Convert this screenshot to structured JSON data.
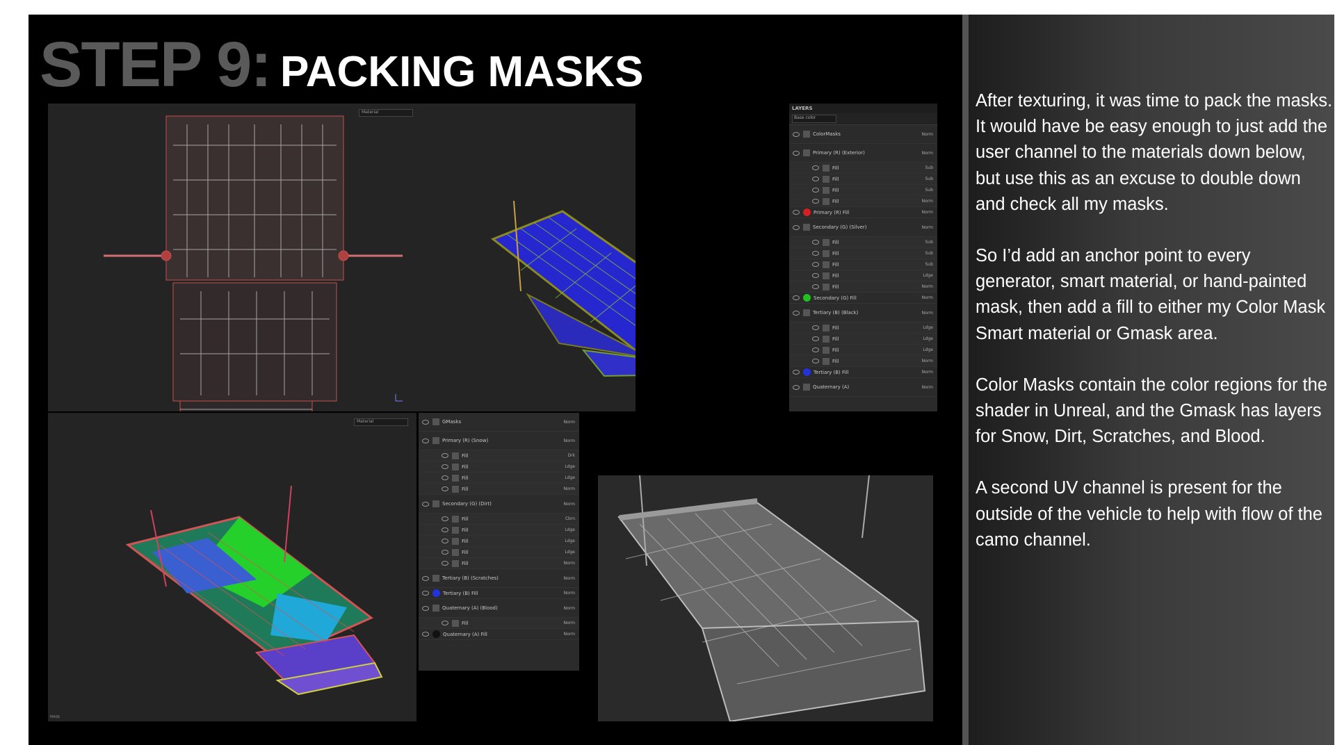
{
  "title": {
    "step": "STEP 9:",
    "main": "PACKING MASKS"
  },
  "description": [
    "After texturing, it was time to pack the masks. It would have be easy enough to just add the user channel to the materials down below, but use this as an excuse to double down and check all my masks.",
    "So I’d add an anchor point to every generator, smart material, or hand-painted mask, then add a fill to either my Color Mask Smart material or Gmask area.",
    "Color Masks contain the color regions for the shader in Unreal, and the Gmask has layers for Snow, Dirt, Scratches, and Blood.",
    "A second UV channel is present for the outside of the vehicle to help with flow of the camo channel."
  ],
  "viewport_top": {
    "dropdown": "Material"
  },
  "viewport_bottom": {
    "dropdown": "Material",
    "footer": "MASK"
  },
  "layers_panel_1": {
    "header": "LAYERS",
    "channel": "Base color",
    "rows": [
      {
        "type": "group",
        "name": "ColorMasks",
        "blend": "Norm"
      },
      {
        "type": "group",
        "name": "Primary (R) (Exterior)",
        "blend": "Norm"
      },
      {
        "type": "sub",
        "name": "Fill",
        "blend": "Sub"
      },
      {
        "type": "sub",
        "name": "Fill",
        "blend": "Sub"
      },
      {
        "type": "sub",
        "name": "Fill",
        "blend": "Sub"
      },
      {
        "type": "sub",
        "name": "Fill",
        "blend": "Norm"
      },
      {
        "type": "fill",
        "name": "Primary (R) Fill",
        "blend": "Norm",
        "ball": "#d42020"
      },
      {
        "type": "group",
        "name": "Secondary (G) (Silver)",
        "blend": "Norm"
      },
      {
        "type": "sub",
        "name": "Fill",
        "blend": "Sub"
      },
      {
        "type": "sub",
        "name": "Fill",
        "blend": "Sub"
      },
      {
        "type": "sub",
        "name": "Fill",
        "blend": "Sub"
      },
      {
        "type": "sub",
        "name": "Fill",
        "blend": "Ldge"
      },
      {
        "type": "sub",
        "name": "Fill",
        "blend": "Norm"
      },
      {
        "type": "fill",
        "name": "Secondary (G) Fill",
        "blend": "Norm",
        "ball": "#22c022"
      },
      {
        "type": "group",
        "name": "Tertiary (B) (Black)",
        "blend": "Norm"
      },
      {
        "type": "sub",
        "name": "Fill",
        "blend": "Ldge"
      },
      {
        "type": "sub",
        "name": "Fill",
        "blend": "Ldge"
      },
      {
        "type": "sub",
        "name": "Fill",
        "blend": "Ldge"
      },
      {
        "type": "sub",
        "name": "Fill",
        "blend": "Norm"
      },
      {
        "type": "fill",
        "name": "Tertiary (B) Fill",
        "blend": "Norm",
        "ball": "#2233dd"
      },
      {
        "type": "group",
        "name": "Quaternary (A)",
        "blend": "Norm"
      }
    ]
  },
  "layers_panel_2": {
    "rows": [
      {
        "type": "group",
        "name": "GMasks",
        "blend": "Norm"
      },
      {
        "type": "group",
        "name": "Primary (R) (Snow)",
        "blend": "Norm"
      },
      {
        "type": "sub",
        "name": "Fill",
        "blend": "Drk"
      },
      {
        "type": "sub",
        "name": "Fill",
        "blend": "Ldge"
      },
      {
        "type": "sub",
        "name": "Fill",
        "blend": "Ldge"
      },
      {
        "type": "sub",
        "name": "Fill",
        "blend": "Norm"
      },
      {
        "type": "group",
        "name": "Secondary (G) (Dirt)",
        "blend": "Norm"
      },
      {
        "type": "sub",
        "name": "Fill",
        "blend": "Cbrn"
      },
      {
        "type": "sub",
        "name": "Fill",
        "blend": "Ldge"
      },
      {
        "type": "sub",
        "name": "Fill",
        "blend": "Ldge"
      },
      {
        "type": "sub",
        "name": "Fill",
        "blend": "Ldge"
      },
      {
        "type": "sub",
        "name": "Fill",
        "blend": "Norm"
      },
      {
        "type": "group",
        "name": "Tertiary (B) (Scratches)",
        "blend": "Norm"
      },
      {
        "type": "fill",
        "name": "Tertiary (B) Fill",
        "blend": "Norm",
        "ball": "#2233dd"
      },
      {
        "type": "group",
        "name": "Quaternary (A) (Blood)",
        "blend": "Norm"
      },
      {
        "type": "sub",
        "name": "Fill",
        "blend": "Norm"
      },
      {
        "type": "fill",
        "name": "Quaternary (A) Fill",
        "blend": "Norm",
        "ball": "#111111"
      }
    ]
  }
}
